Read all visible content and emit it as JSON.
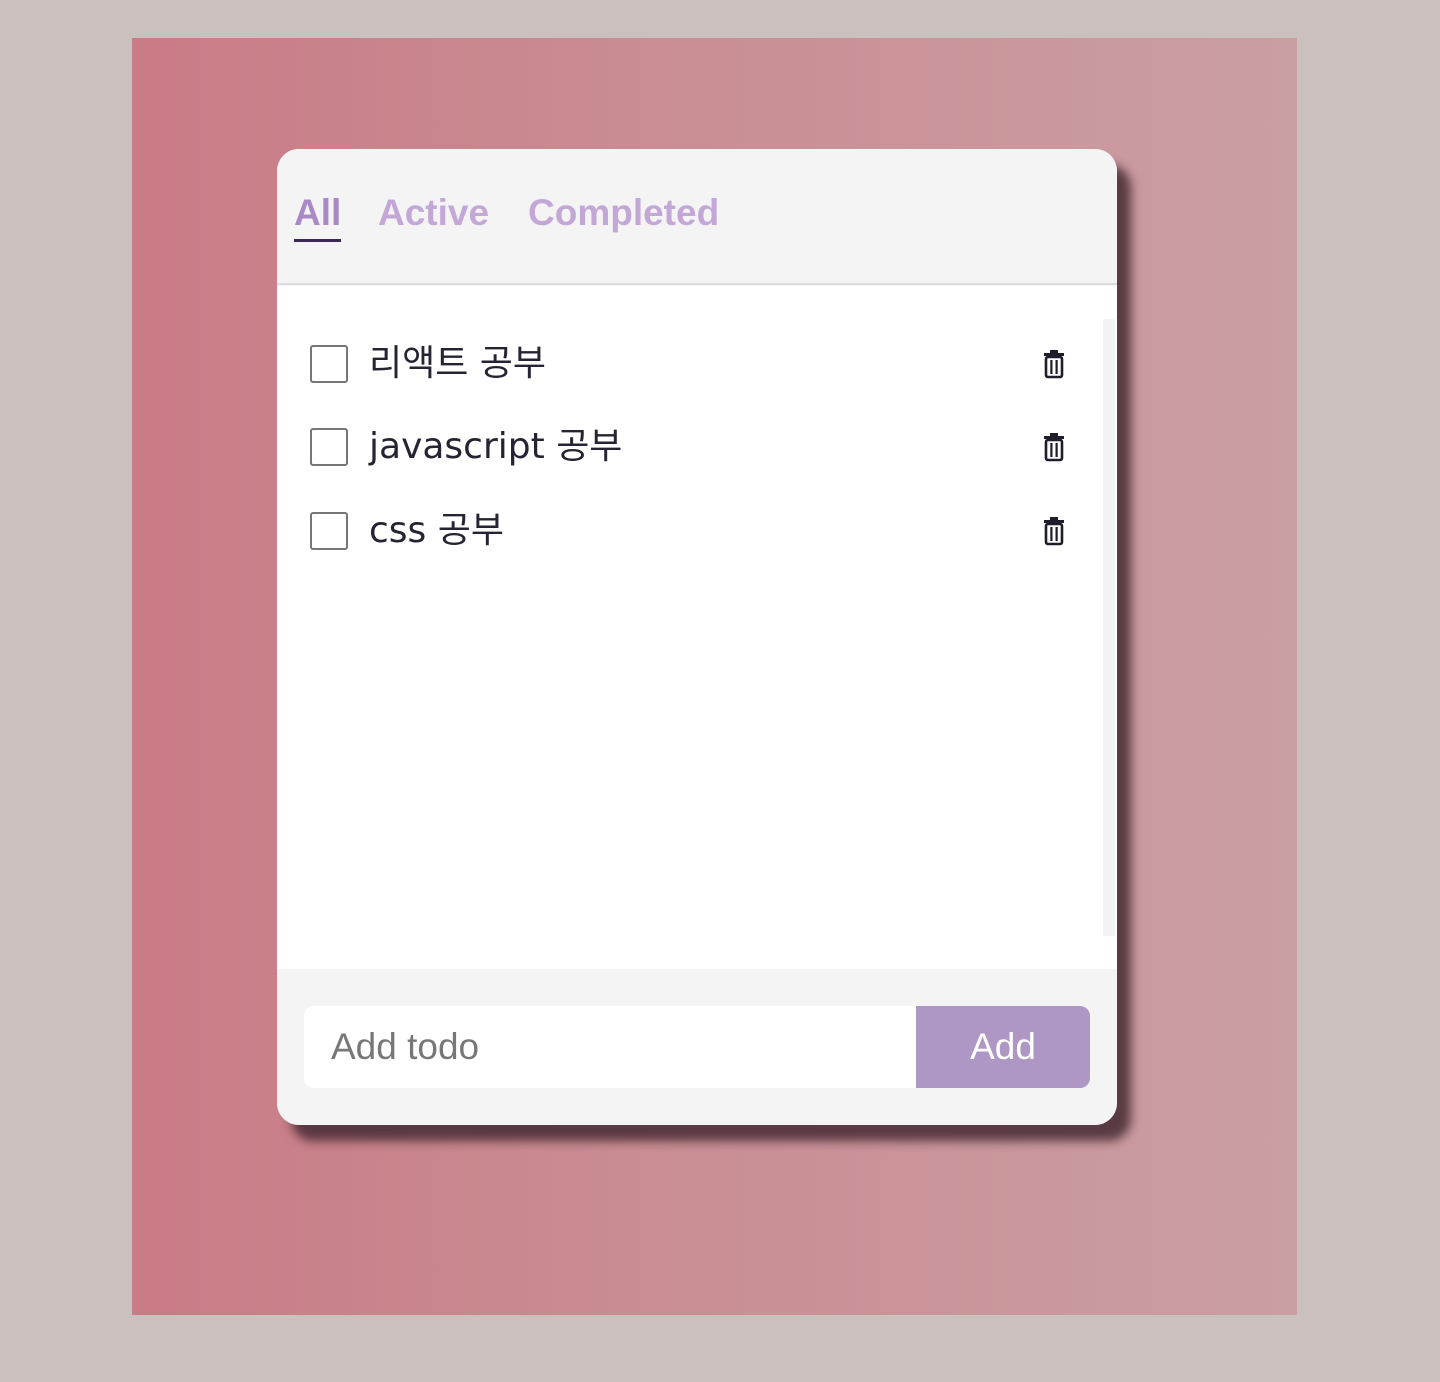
{
  "tabs": {
    "all": "All",
    "active": "Active",
    "completed": "Completed",
    "selected": "All"
  },
  "todos": [
    {
      "text": "리액트 공부",
      "completed": false
    },
    {
      "text": "javascript 공부",
      "completed": false
    },
    {
      "text": "css 공부",
      "completed": false
    }
  ],
  "form": {
    "placeholder": "Add todo",
    "value": "",
    "add_label": "Add"
  },
  "icons": {
    "delete": "trash-icon"
  },
  "colors": {
    "accent": "#ae97c4",
    "tab_selected": "#a98ac7",
    "tab_inactive": "#c3a7d6",
    "text": "#262332"
  }
}
